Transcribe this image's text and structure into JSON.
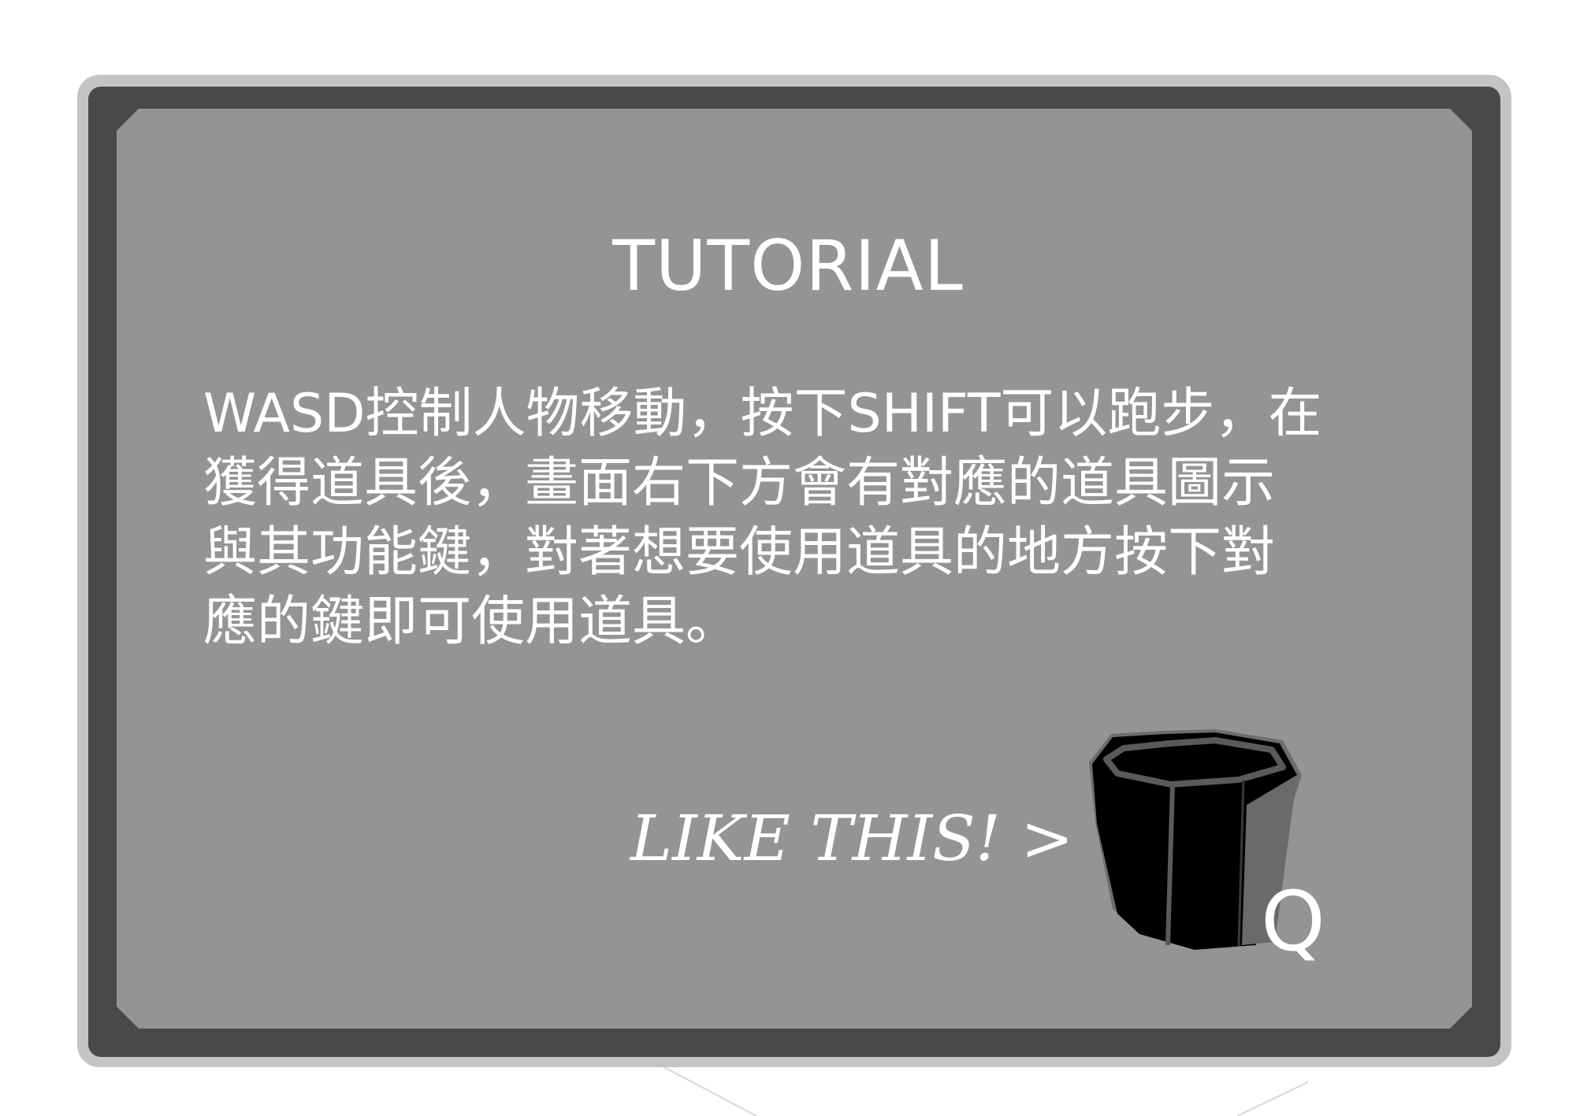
{
  "tutorial": {
    "title": "TUTORIAL",
    "description_lines": [
      "WASD控制人物移動，按下SHIFT可以跑步，在",
      "獲得道具後，畫面右下方會有對應的道具圖示",
      "與其功能鍵，對著想要使用道具的地方按下對",
      "應的鍵即可使用道具。"
    ],
    "example_label": "LIKE THIS! >",
    "item": {
      "icon": "bucket-icon",
      "key": "Q"
    }
  },
  "colors": {
    "frame_outer": "#c4c4c4",
    "frame_inner": "#494949",
    "board": "#949494",
    "text": "#ffffff"
  }
}
